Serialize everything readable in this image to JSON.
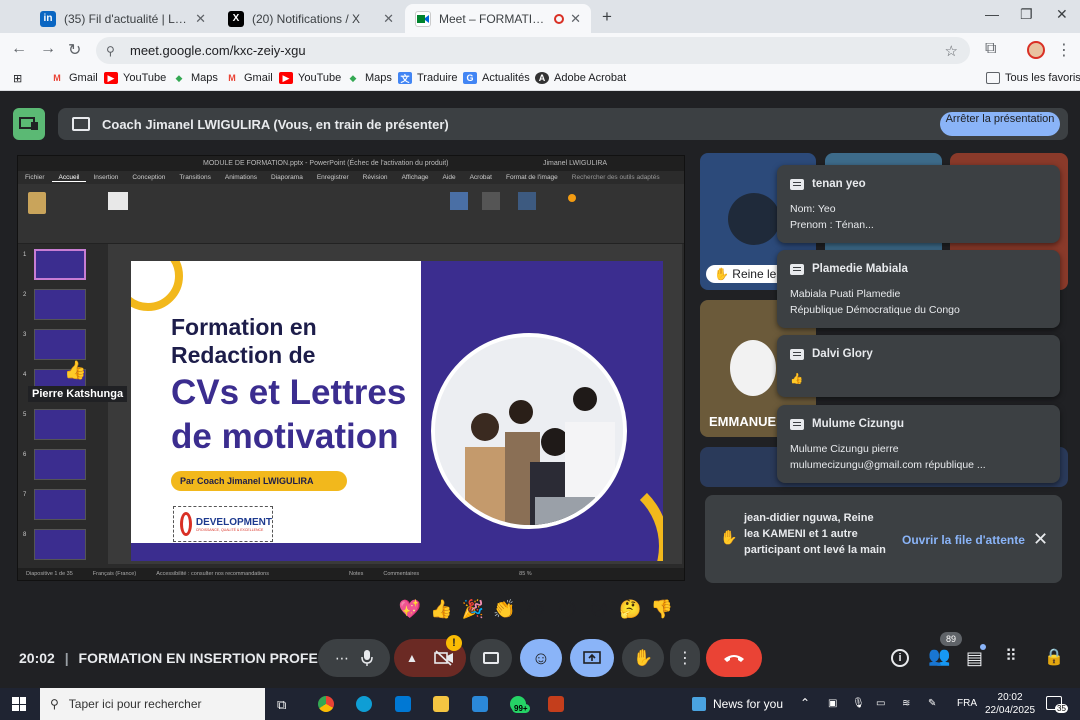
{
  "browser": {
    "tabs": [
      {
        "title": "(35) Fil d'actualité | LinkedIn",
        "icon": "linkedin-icon",
        "active": false
      },
      {
        "title": "(20) Notifications / X",
        "icon": "x-icon",
        "active": false
      },
      {
        "title": "Meet – FORMATION EN INS",
        "icon": "meet-icon",
        "active": true
      }
    ],
    "url": "meet.google.com/kxc-zeiy-xgu",
    "bookmarks": [
      {
        "label": "Gmail",
        "icon": "gmail-icon"
      },
      {
        "label": "YouTube",
        "icon": "youtube-icon"
      },
      {
        "label": "Maps",
        "icon": "maps-icon"
      },
      {
        "label": "Gmail",
        "icon": "gmail-icon"
      },
      {
        "label": "YouTube",
        "icon": "youtube-icon"
      },
      {
        "label": "Maps",
        "icon": "maps-icon"
      },
      {
        "label": "Traduire",
        "icon": "translate-icon"
      },
      {
        "label": "Actualités",
        "icon": "news-icon"
      },
      {
        "label": "Adobe Acrobat",
        "icon": "acrobat-icon"
      }
    ],
    "all_bookmarks": "Tous les favoris"
  },
  "meet": {
    "presenting_banner": "Coach Jimanel LWIGULIRA (Vous, en train de présenter)",
    "stop_presenting": "Arrêter la présentation",
    "meeting_time": "20:02",
    "meeting_title": "FORMATION EN INSERTION PROFESS...",
    "participant_count": "89",
    "raised_hand_notice": {
      "text": "jean-didier nguwa, Reine lea KAMENI et 1 autre participant ont levé la main",
      "action": "Ouvrir la file d'attente"
    },
    "tiles": [
      {
        "name": "Reine lea"
      },
      {
        "name": "EMMANUEL"
      }
    ],
    "chat_notifications": [
      {
        "name": "tenan yeo",
        "lines": [
          "Nom: Yeo",
          "Prenom : Ténan..."
        ]
      },
      {
        "name": "Plamedie Mabiala",
        "lines": [
          "Mabiala Puati Plamedie",
          "République Démocratique du Congo"
        ]
      },
      {
        "name": "Dalvi Glory",
        "lines": [
          "👍"
        ]
      },
      {
        "name": "Mulume Cizungu",
        "lines": [
          "Mulume Cizungu pierre",
          "mulumecizungu@gmail.com république ..."
        ]
      }
    ],
    "reactions": [
      "💖",
      "👍",
      "🎉",
      "👏",
      "😂",
      "😮",
      "😢",
      "🤔",
      "👎"
    ]
  },
  "powerpoint": {
    "window_title": "MODULE DE FORMATION.pptx - PowerPoint (Échec de l'activation du produit)",
    "user": "Jimanel LWIGULIRA",
    "ribbon_tabs": [
      "Fichier",
      "Accueil",
      "Insertion",
      "Conception",
      "Transitions",
      "Animations",
      "Diaporama",
      "Enregistrer",
      "Révision",
      "Affichage",
      "Aide",
      "Acrobat",
      "Format de l'image"
    ],
    "search_hint": "Rechercher des outils adaptés",
    "slide_count_label": "Diapositive 1 de 35",
    "language": "Français (France)",
    "accessibility": "Accessibilité : consulter nos recommandations",
    "notes": "Notes",
    "comments": "Commentaires",
    "zoom": "85 %",
    "hover_name": "Pierre Katshunga",
    "slide": {
      "title_line1": "Formation en",
      "title_line2": "Redaction de",
      "headline_line1": "CVs et Lettres",
      "headline_line2": "de motivation",
      "byline": "Par Coach Jimanel LWIGULIRA",
      "logo_text": "DEVELOPMENT",
      "logo_tagline": "CROISSANCE, QUALITÉ & EXCELLENCE"
    }
  },
  "taskbar": {
    "search_placeholder": "Taper ici pour rechercher",
    "news": "News for you",
    "lang": "FRA",
    "time": "20:02",
    "date": "22/04/2025",
    "badge": "99+",
    "notif_count": "35"
  }
}
